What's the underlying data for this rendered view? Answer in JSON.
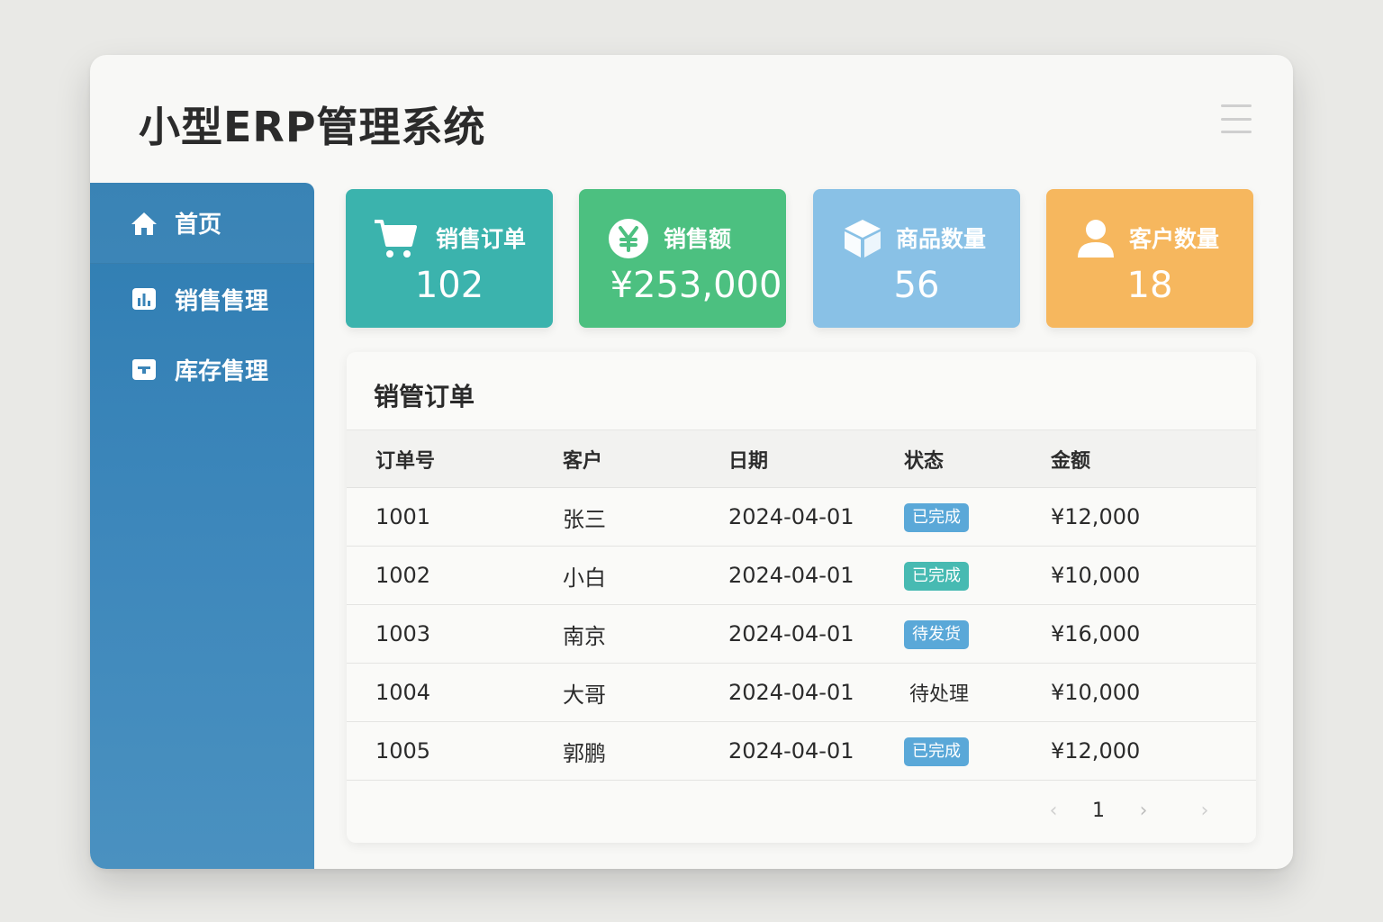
{
  "app": {
    "title": "小型ERP管理系统"
  },
  "sidebar": {
    "items": [
      {
        "label": "首页",
        "icon": "home-icon"
      },
      {
        "label": "销售售理",
        "icon": "bar-chart-icon"
      },
      {
        "label": "库存售理",
        "icon": "inventory-box-icon"
      }
    ]
  },
  "cards": [
    {
      "label": "销售订单",
      "value": "102",
      "icon": "cart-icon",
      "color": "#3bb3ad"
    },
    {
      "label": "销售额",
      "value": "¥253,000",
      "icon": "yen-icon",
      "color": "#4cc080"
    },
    {
      "label": "商品数量",
      "value": "56",
      "icon": "cube-icon",
      "color": "#89c1e6"
    },
    {
      "label": "客户数量",
      "value": "18",
      "icon": "user-icon",
      "color": "#f6b75e"
    }
  ],
  "orders": {
    "title": "销管订单",
    "columns": [
      "订单号",
      "客户",
      "日期",
      "状态",
      "金额"
    ],
    "rows": [
      {
        "id": "1001",
        "customer": "张三",
        "date": "2024-04-01",
        "status": "已完成",
        "status_style": "badge",
        "status_color": "#5aa8d8",
        "amount": "¥12,000"
      },
      {
        "id": "1002",
        "customer": "小白",
        "date": "2024-04-01",
        "status": "已完成",
        "status_style": "badge",
        "status_color": "#47bab2",
        "amount": "¥10,000"
      },
      {
        "id": "1003",
        "customer": "南京",
        "date": "2024-04-01",
        "status": "待发货",
        "status_style": "badge",
        "status_color": "#5aa8d8",
        "amount": "¥16,000"
      },
      {
        "id": "1004",
        "customer": "大哥",
        "date": "2024-04-01",
        "status": "待处理",
        "status_style": "plain",
        "status_color": "#2b2b2b",
        "amount": "¥10,000"
      },
      {
        "id": "1005",
        "customer": "郭鹏",
        "date": "2024-04-01",
        "status": "已完成",
        "status_style": "badge",
        "status_color": "#5aa8d8",
        "amount": "¥12,000"
      }
    ]
  },
  "pagination": {
    "prev": "‹",
    "current": "1",
    "next": "›",
    "last": "›"
  },
  "colors": {
    "sidebar": "#3a84b8",
    "accent_text": "#2b2b2b"
  }
}
